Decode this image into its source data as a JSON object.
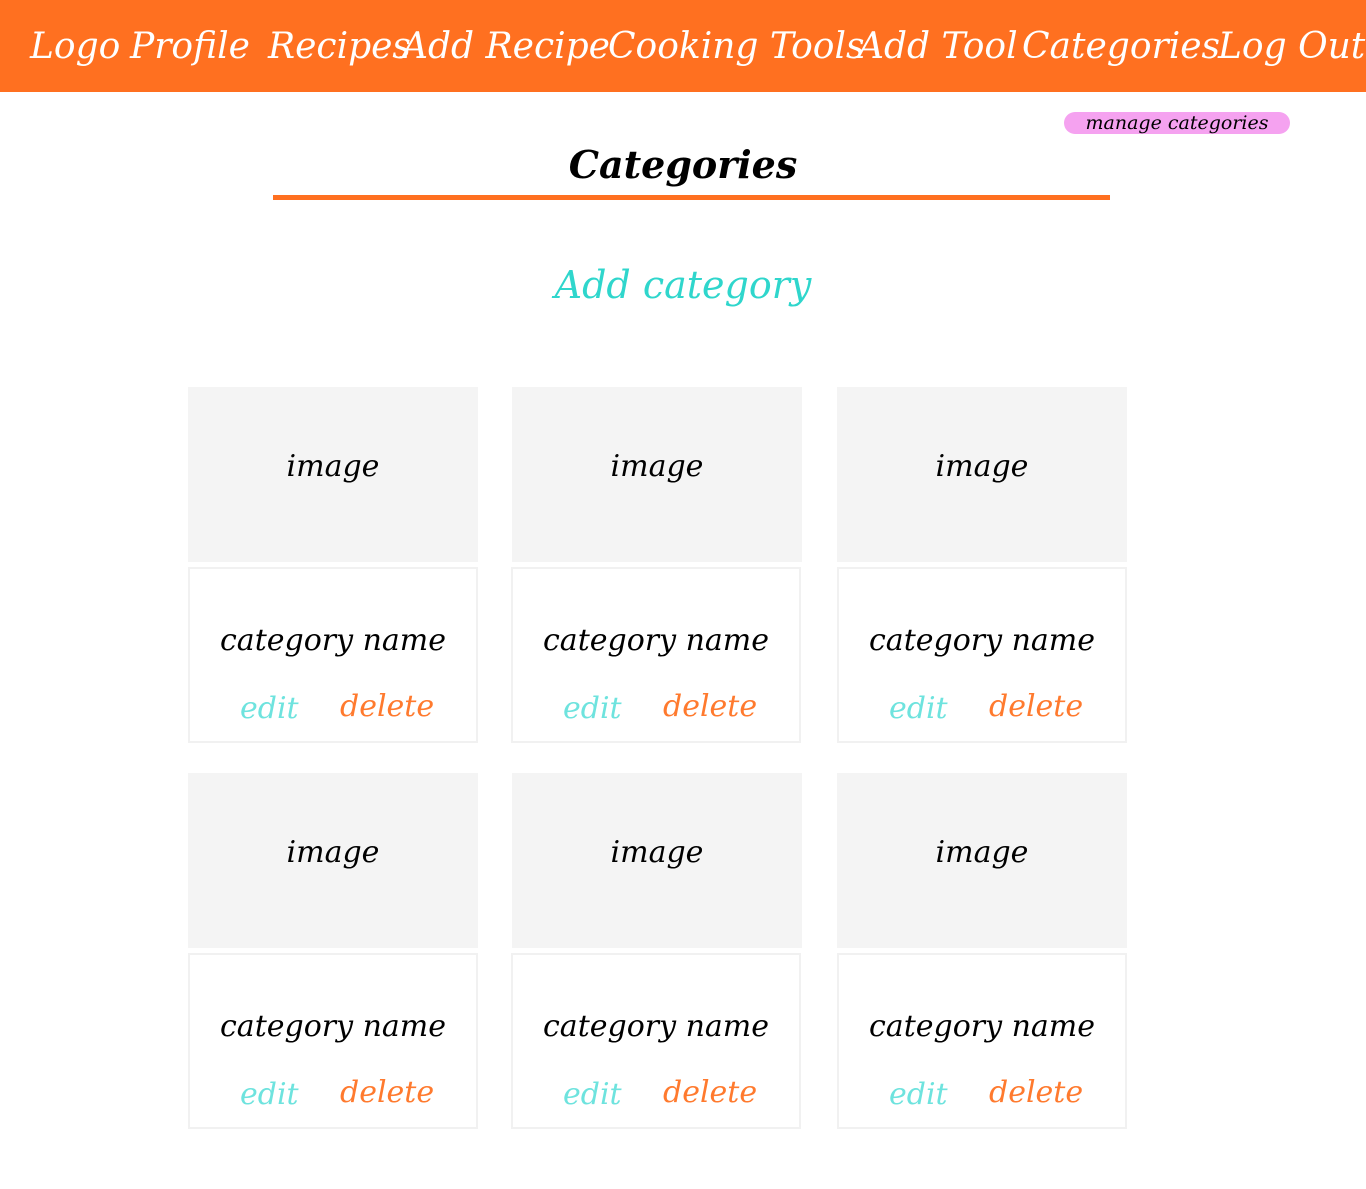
{
  "nav": {
    "logo": "Logo",
    "profile": "Profile",
    "recipes": "Recipes",
    "add_recipe": "Add Recipe",
    "cooking_tools": "Cooking Tools",
    "add_tool": "Add Tool",
    "categories": "Categories",
    "log_out": "Log Out"
  },
  "manage_link": "manage categories",
  "page_title": "Categories",
  "add_category_label": "Add category",
  "cards": [
    {
      "image_label": "image",
      "name": "category name",
      "edit_label": "edit",
      "delete_label": "delete"
    },
    {
      "image_label": "image",
      "name": "category name",
      "edit_label": "edit",
      "delete_label": "delete"
    },
    {
      "image_label": "image",
      "name": "category name",
      "edit_label": "edit",
      "delete_label": "delete"
    },
    {
      "image_label": "image",
      "name": "category name",
      "edit_label": "edit",
      "delete_label": "delete"
    },
    {
      "image_label": "image",
      "name": "category name",
      "edit_label": "edit",
      "delete_label": "delete"
    },
    {
      "image_label": "image",
      "name": "category name",
      "edit_label": "edit",
      "delete_label": "delete"
    }
  ],
  "colors": {
    "brand_orange": "#ff7020",
    "accent_teal": "#2fd6cc",
    "edit_teal": "#6ee3de",
    "delete_orange": "#ff7a2e",
    "manage_pink": "#f5a2f0",
    "image_gray": "#f4f4f4"
  }
}
